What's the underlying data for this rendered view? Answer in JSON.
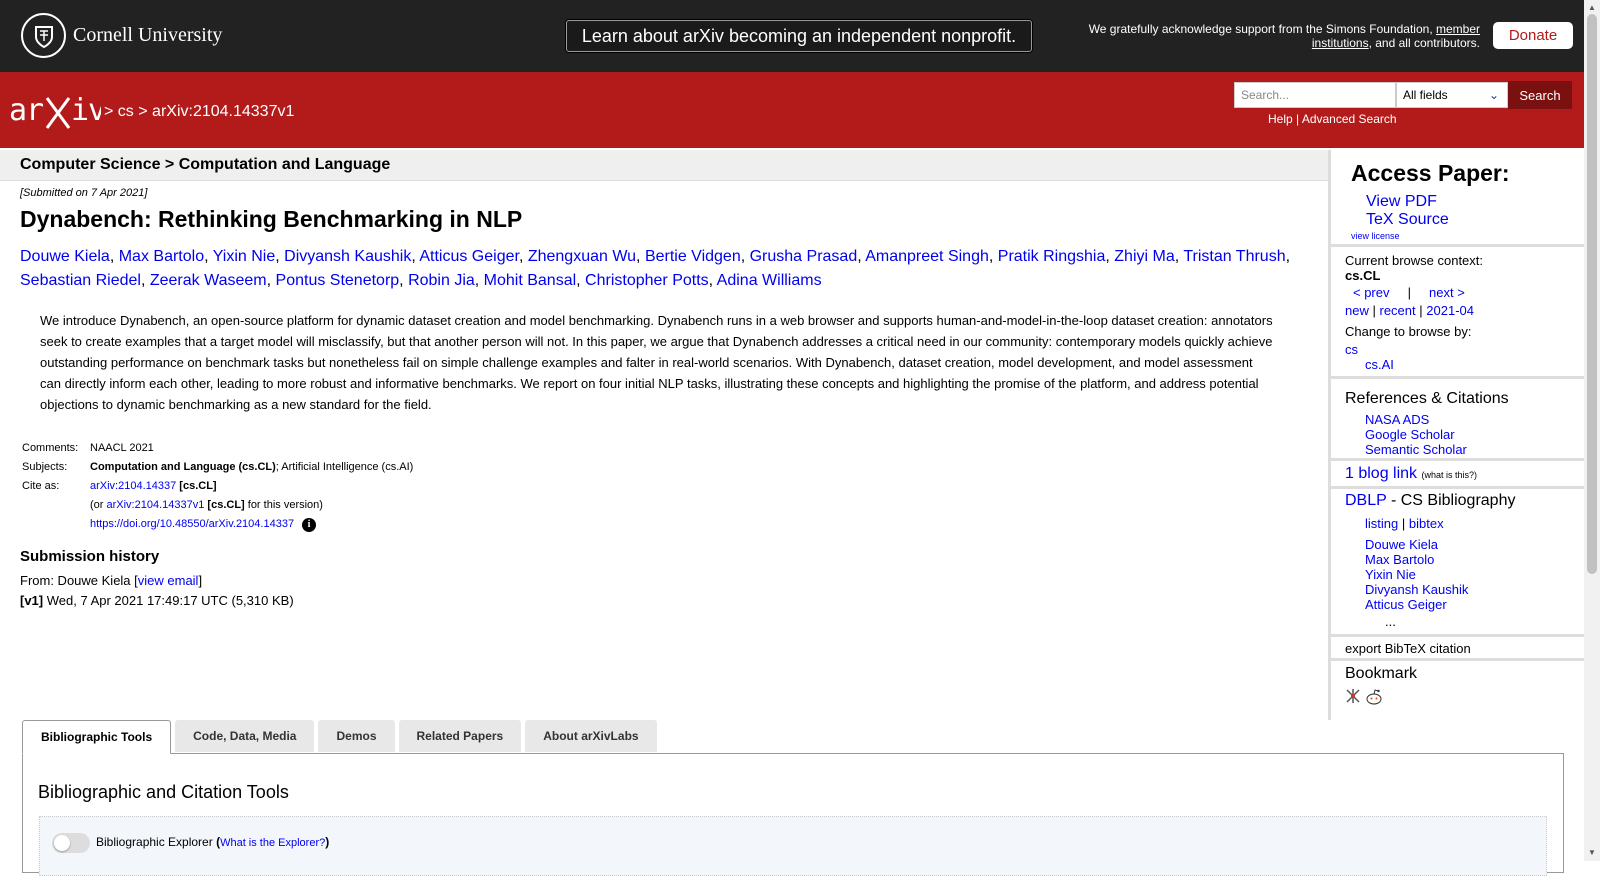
{
  "topbar": {
    "university": "Cornell University",
    "banner": "Learn about arXiv becoming an independent nonprofit.",
    "ack_prefix": "We gratefully acknowledge support from the Simons Foundation, ",
    "ack_link": "member institutions",
    "ack_suffix": ", and all contributors.",
    "donate": "Donate"
  },
  "header": {
    "crumb_sep1": ">",
    "crumb_cs": "cs",
    "crumb_sep2": ">",
    "crumb_id": "arXiv:2104.14337v1",
    "search_placeholder": "Search...",
    "search_field": "All fields",
    "search_button": "Search",
    "help": "Help",
    "pipe": "|",
    "advanced": "Advanced Search"
  },
  "paper": {
    "subject_bar": "Computer Science > Computation and Language",
    "submitted": "[Submitted on 7 Apr 2021]",
    "title": "Dynabench: Rethinking Benchmarking in NLP",
    "authors": [
      "Douwe Kiela",
      "Max Bartolo",
      "Yixin Nie",
      "Divyansh Kaushik",
      "Atticus Geiger",
      "Zhengxuan Wu",
      "Bertie Vidgen",
      "Grusha Prasad",
      "Amanpreet Singh",
      "Pratik Ringshia",
      "Zhiyi Ma",
      "Tristan Thrush",
      "Sebastian Riedel",
      "Zeerak Waseem",
      "Pontus Stenetorp",
      "Robin Jia",
      "Mohit Bansal",
      "Christopher Potts",
      "Adina Williams"
    ],
    "abstract": "We introduce Dynabench, an open-source platform for dynamic dataset creation and model benchmarking. Dynabench runs in a web browser and supports human-and-model-in-the-loop dataset creation: annotators seek to create examples that a target model will misclassify, but that another person will not. In this paper, we argue that Dynabench addresses a critical need in our community: contemporary models quickly achieve outstanding performance on benchmark tasks but nonetheless fail on simple challenge examples and falter in real-world scenarios. With Dynabench, dataset creation, model development, and model assessment can directly inform each other, leading to more robust and informative benchmarks. We report on four initial NLP tasks, illustrating these concepts and highlighting the promise of the platform, and address potential objections to dynamic benchmarking as a new standard for the field.",
    "meta": {
      "comments_label": "Comments:",
      "comments": "NAACL 2021",
      "subjects_label": "Subjects:",
      "subjects_primary": "Computation and Language (cs.CL)",
      "subjects_rest": "; Artificial Intelligence (cs.AI)",
      "cite_label": "Cite as:",
      "cite_id": "arXiv:2104.14337",
      "cite_cat": "[cs.CL]",
      "version_prefix": "(or ",
      "version_id": "arXiv:2104.14337v1",
      "version_cat": "[cs.CL]",
      "version_suffix": " for this version)",
      "doi": "https://doi.org/10.48550/arXiv.2104.14337"
    },
    "history": {
      "heading": "Submission history",
      "from_prefix": "From: Douwe Kiela [",
      "view_email": "view email",
      "from_suffix": "]",
      "v1_label": "[v1]",
      "v1_text": " Wed, 7 Apr 2021 17:49:17 UTC (5,310 KB)"
    }
  },
  "sidebar": {
    "access_title": "Access Paper:",
    "view_pdf": "View PDF",
    "tex_source": "TeX Source",
    "view_license": "view license",
    "context_label": "Current browse context:",
    "context_value": "cs.CL",
    "prev": "< prev",
    "pipe": "|",
    "next": "next >",
    "new": "new",
    "recent": "recent",
    "month": "2021-04",
    "change_label": "Change to browse by:",
    "cs": "cs",
    "csai": "cs.AI",
    "refs_title": "References & Citations",
    "refs": [
      "NASA ADS",
      "Google Scholar",
      "Semantic Scholar"
    ],
    "blog_link": "1 blog link",
    "blog_what": "(what is this?)",
    "dblp": "DBLP",
    "dblp_suffix": " - CS Bibliography",
    "listing": "listing",
    "bibtex": "bibtex",
    "dblp_authors": [
      "Douwe Kiela",
      "Max Bartolo",
      "Yixin Nie",
      "Divyansh Kaushik",
      "Atticus Geiger"
    ],
    "ellipsis": "...",
    "export": "export BibTeX citation",
    "bookmark_title": "Bookmark"
  },
  "tabs": {
    "items": [
      "Bibliographic Tools",
      "Code, Data, Media",
      "Demos",
      "Related Papers",
      "About arXivLabs"
    ],
    "panel_title": "Bibliographic and Citation Tools",
    "explorer_label": "Bibliographic Explorer",
    "explorer_open": " (",
    "explorer_link": "What is the Explorer?",
    "explorer_close": ")"
  },
  "colors": {
    "arxiv_red": "#b31b1b",
    "link": "#0000ee",
    "topbar": "#222222"
  }
}
